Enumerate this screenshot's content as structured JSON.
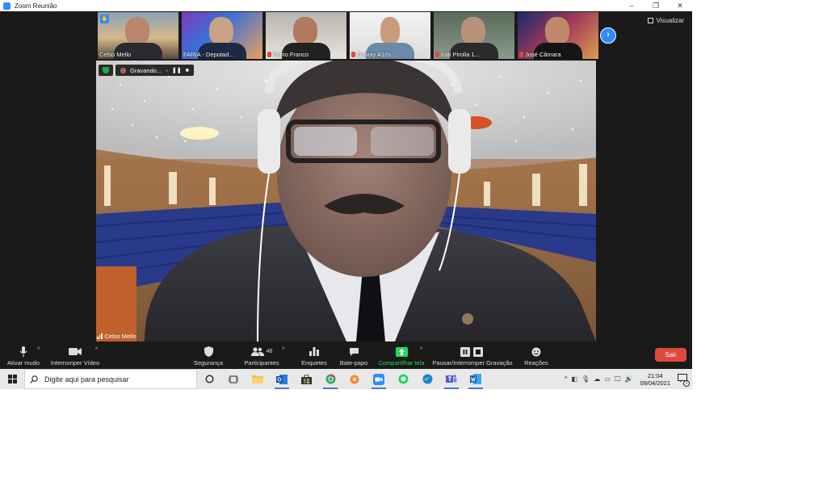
{
  "window": {
    "title": "Zoom Reunião",
    "controls": [
      "–",
      "❐",
      "✕"
    ]
  },
  "view_label": "Visualizar",
  "participants_strip": [
    {
      "name": "Celso Mello",
      "muted": false,
      "active": true,
      "raised_hand": true
    },
    {
      "name": "FARIA - Deputad...",
      "muted": false,
      "active": false,
      "raised_hand": false
    },
    {
      "name": "Mario Franco",
      "muted": true,
      "active": false,
      "raised_hand": false
    },
    {
      "name": "Galaxy A10s ...",
      "muted": true,
      "active": false,
      "raised_hand": false
    },
    {
      "name": "Irati Pirolla 1...",
      "muted": true,
      "active": false,
      "raised_hand": false
    },
    {
      "name": "José Câmara",
      "muted": true,
      "active": false,
      "raised_hand": false
    }
  ],
  "recording": {
    "label": "Gravando..."
  },
  "speaker": {
    "name": "Celso Mello"
  },
  "toolbar": {
    "mute": "Ativar mudo",
    "video": "Interromper Vídeo",
    "security": "Segurança",
    "participants": "Participantes",
    "participants_count": "46",
    "polls": "Enquetes",
    "chat": "Bate-papo",
    "share": "Compartilhar tela",
    "record": "Pausar/Interromper Gravação",
    "reactions": "Reações",
    "leave": "Sair"
  },
  "taskbar": {
    "search_placeholder": "Digite aqui para pesquisar",
    "time": "21:04",
    "date": "09/04/2021",
    "notification_count": "1"
  },
  "colors": {
    "accent": "#2d8cff",
    "leave": "#e0483e",
    "share": "#23d959"
  }
}
